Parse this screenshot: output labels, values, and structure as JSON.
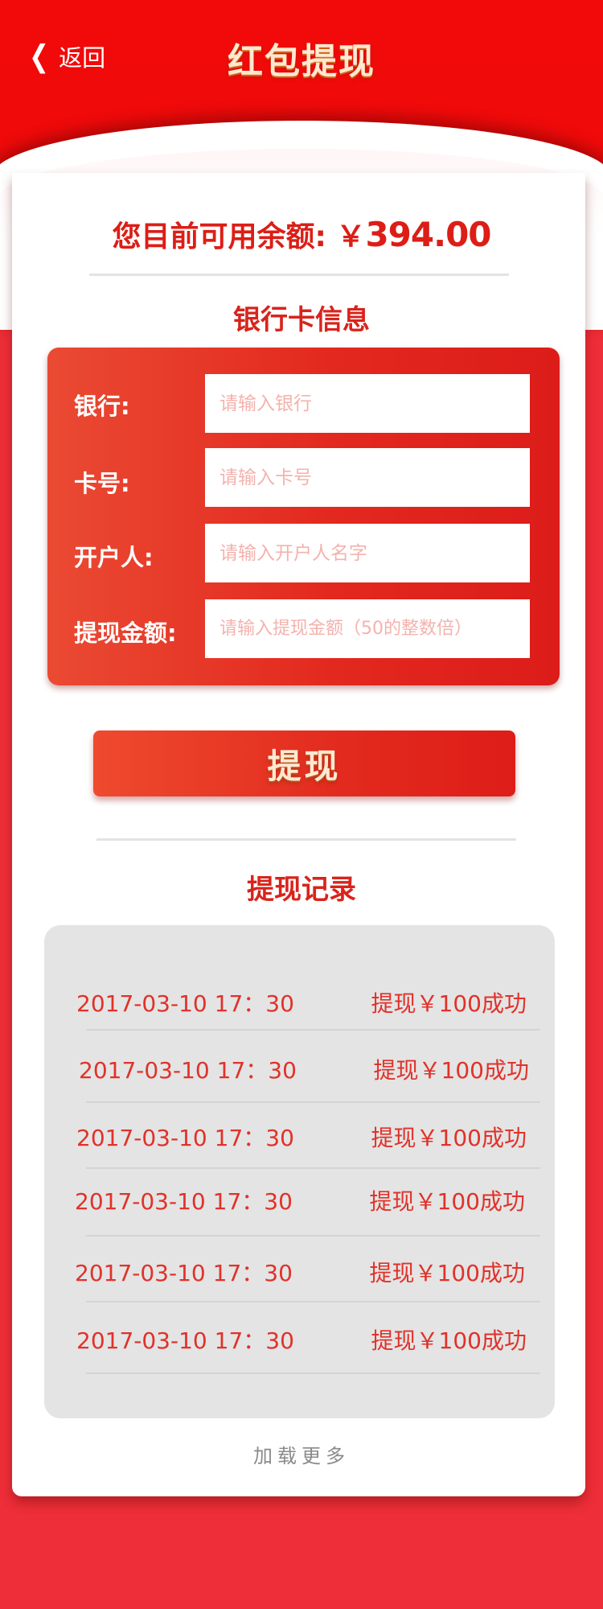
{
  "header": {
    "back_label": "返回",
    "title": "红包提现"
  },
  "balance": {
    "label": "您目前可用余额: ",
    "currency": "￥",
    "amount": "394.00"
  },
  "bank_section": {
    "title": "银行卡信息",
    "fields": [
      {
        "label": "银行:",
        "placeholder": "请输入银行"
      },
      {
        "label": "卡号:",
        "placeholder": "请输入卡号"
      },
      {
        "label": "开户人:",
        "placeholder": "请输入开户人名字"
      },
      {
        "label": "提现金额:",
        "placeholder": "请输入提现金额（50的整数倍）"
      }
    ]
  },
  "submit_label": "提现",
  "records_section": {
    "title": "提现记录",
    "rows": [
      {
        "time": "2017-03-10 17：30",
        "result": "提现￥100成功"
      },
      {
        "time": "2017-03-10 17：30",
        "result": "提现￥100成功"
      },
      {
        "time": "2017-03-10 17：30",
        "result": "提现￥100成功"
      },
      {
        "time": "2017-03-10 17：30",
        "result": "提现￥100成功"
      },
      {
        "time": "2017-03-10 17：30",
        "result": "提现￥100成功"
      },
      {
        "time": "2017-03-10 17：30",
        "result": "提现￥100成功"
      }
    ]
  },
  "load_more_label": "加载更多",
  "colors": {
    "brand_red": "#f20a0a",
    "accent_text": "#dc1e16",
    "title_cream": "#ffe9d0",
    "records_bg": "#e4e4e4"
  },
  "icons": {
    "back": "chevron-left-icon"
  }
}
